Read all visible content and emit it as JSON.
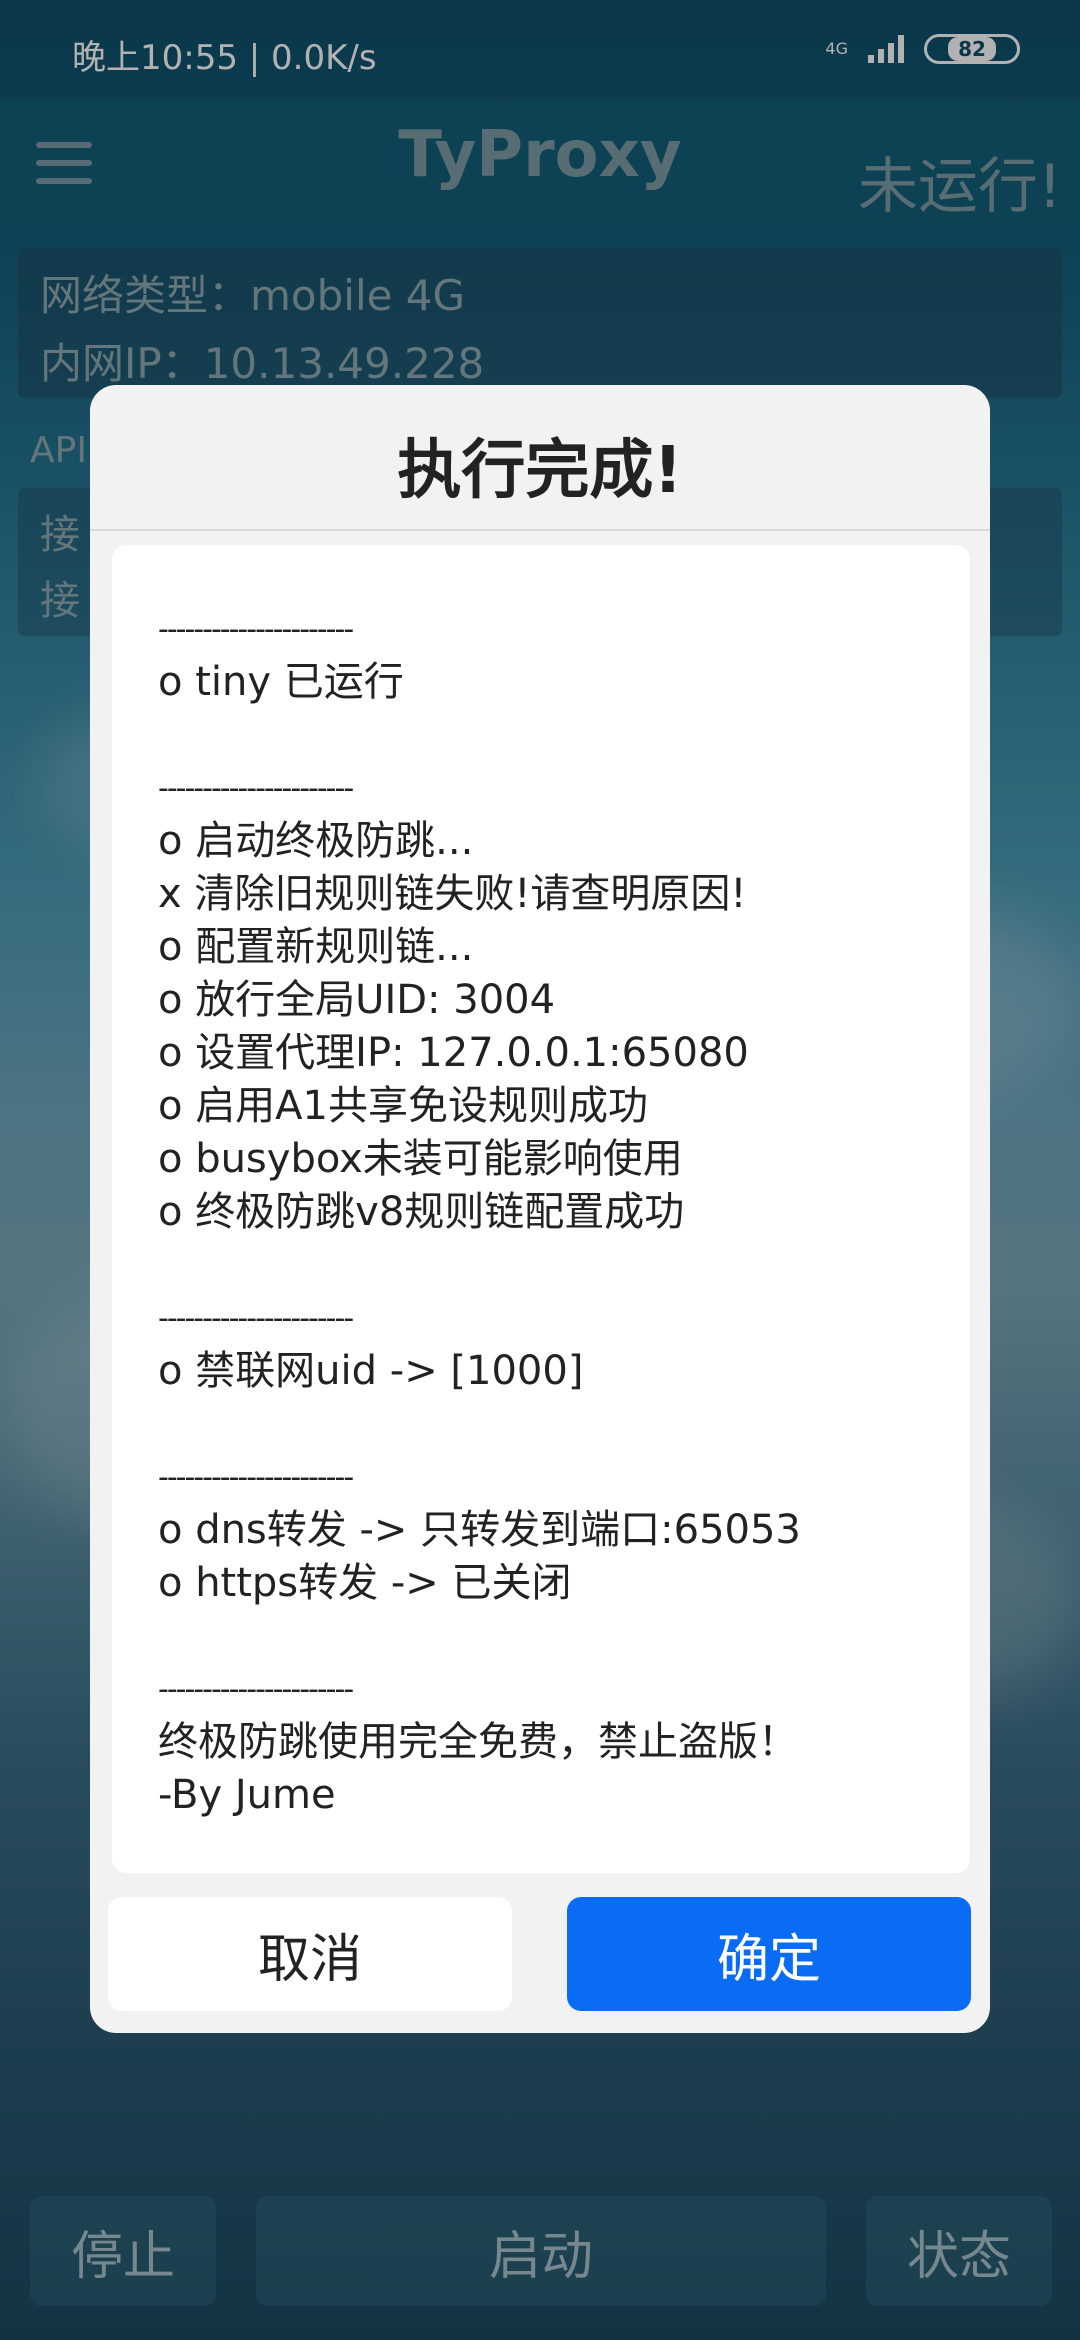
{
  "status_bar": {
    "time": "晚上10:55 | 0.0K/s",
    "network": "4G",
    "battery": "82"
  },
  "app_bar": {
    "title": "TyProxy",
    "status": "未运行!"
  },
  "info": {
    "network_type": "网络类型：mobile 4G",
    "intranet_ip": "内网IP：10.13.49.228"
  },
  "api": {
    "label": "API",
    "line1": "接",
    "line2": "接"
  },
  "bottom": {
    "stop": "停止",
    "start": "启动",
    "status": "状态"
  },
  "dialog": {
    "title": "执行完成!",
    "lines": [
      "----------------------",
      "o tiny 已运行",
      "",
      "----------------------",
      "o 启动终极防跳...",
      "x 清除旧规则链失败!请查明原因!",
      "o 配置新规则链...",
      "o 放行全局UID: 3004",
      "o 设置代理IP: 127.0.0.1:65080",
      "o 启用A1共享免设规则成功",
      "o busybox未装可能影响使用",
      "o 终极防跳v8规则链配置成功",
      "",
      "----------------------",
      "o 禁联网uid -> [1000]",
      "",
      "----------------------",
      "o dns转发 -> 只转发到端口:65053",
      "o https转发 -> 已关闭",
      "",
      "----------------------",
      "终极防跳使用完全免费，禁止盗版！",
      "-By Jume"
    ],
    "cancel_label": "取消",
    "ok_label": "确定"
  },
  "colors": {
    "primary_button": "#0a6cf5",
    "app_bar": "#145d79"
  }
}
